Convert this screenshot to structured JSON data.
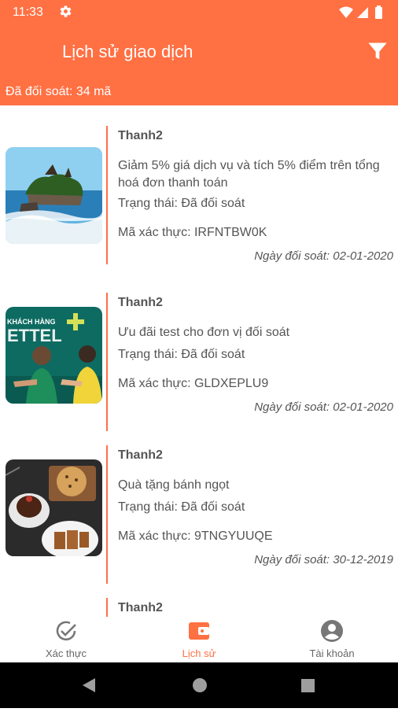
{
  "status_bar": {
    "time": "11:33"
  },
  "header": {
    "title": "Lịch sử giao dịch",
    "summary": "Đã đối soát: 34 mã"
  },
  "colors": {
    "accent": "#FF7043",
    "text": "#555555"
  },
  "transactions": [
    {
      "name": "Thanh2",
      "description": "Giảm 5% giá dịch vụ và tích 5% điểm trên tổng hoá đơn thanh toán",
      "status": "Trạng thái: Đã đối soát",
      "code": "Mã xác thực: IRFNTBW0K",
      "date": "Ngày đối soát: 02-01-2020",
      "image": "beach-temple"
    },
    {
      "name": "Thanh2",
      "description": "Ưu đãi test cho đơn vị đối soát",
      "status": "Trạng thái: Đã đối soát",
      "code": "Mã xác thực: GLDXEPLU9",
      "date": "Ngày đối soát: 02-01-2020",
      "image": "viettel-promo",
      "image_text": "KHÁCH HÀNG"
    },
    {
      "name": "Thanh2",
      "description": "Quà tặng bánh ngọt",
      "status": "Trạng thái: Đã đối soát",
      "code": "Mã xác thực: 9TNGYUUQE",
      "date": "Ngày đối soát: 30-12-2019",
      "image": "cakes"
    },
    {
      "name": "Thanh2"
    }
  ],
  "bottom_nav": [
    {
      "label": "Xác thực",
      "icon": "check-circle-icon",
      "active": false
    },
    {
      "label": "Lịch sử",
      "icon": "wallet-icon",
      "active": true
    },
    {
      "label": "Tài khoản",
      "icon": "account-circle-icon",
      "active": false
    }
  ]
}
